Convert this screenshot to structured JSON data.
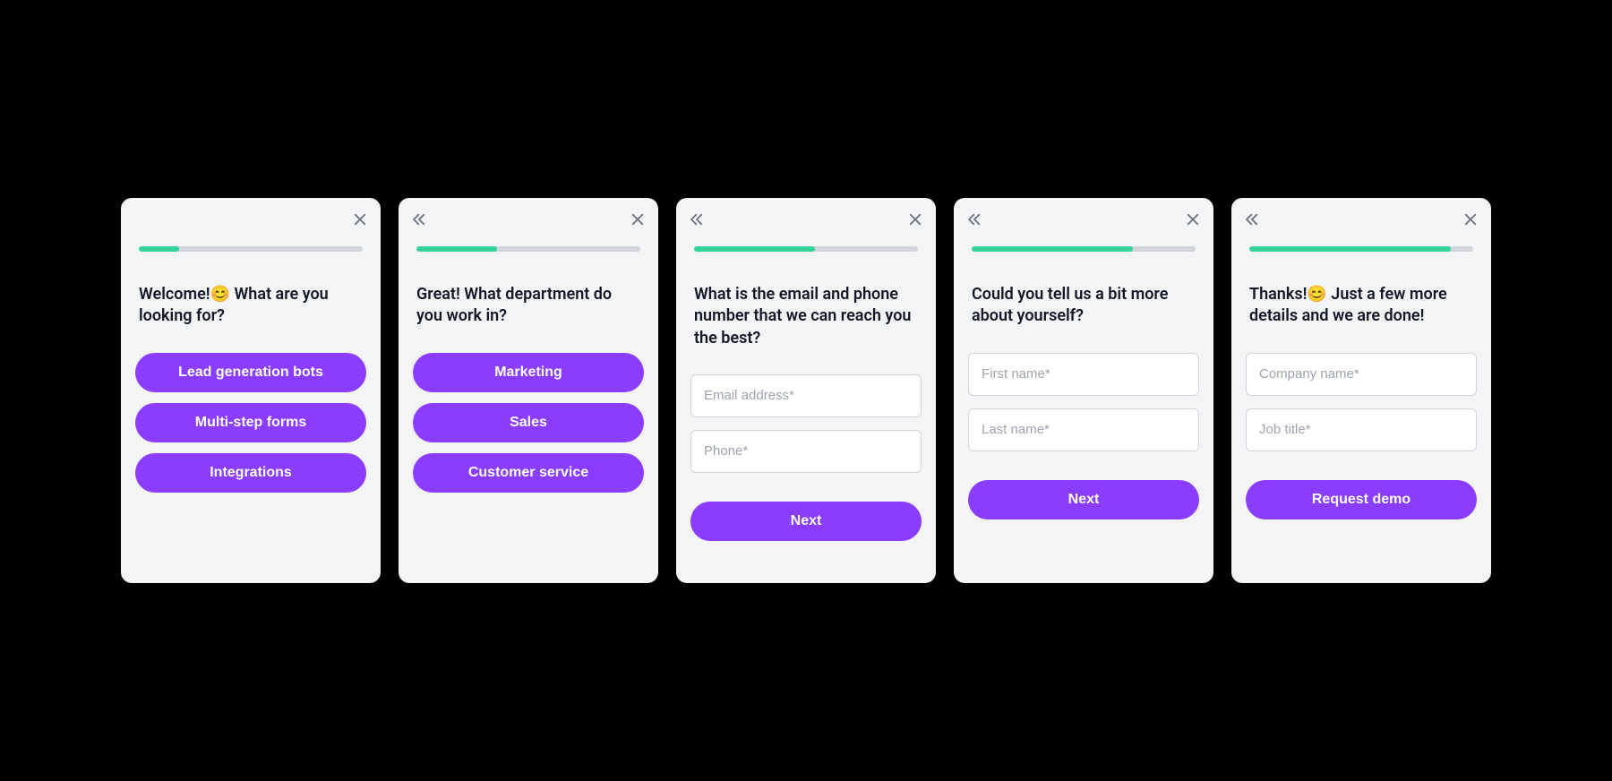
{
  "colors": {
    "accent": "#8b3dff",
    "progress": "#34d399"
  },
  "cards": [
    {
      "has_back": false,
      "progress_pct": 18,
      "prompt": "Welcome!😊 What are you looking for?",
      "type": "options",
      "options": [
        "Lead generation bots",
        "Multi-step forms",
        "Integrations"
      ]
    },
    {
      "has_back": true,
      "progress_pct": 36,
      "prompt": "Great! What department do you work in?",
      "type": "options",
      "options": [
        "Marketing",
        "Sales",
        "Customer service"
      ]
    },
    {
      "has_back": true,
      "progress_pct": 54,
      "prompt": "What is the email and phone number that we can reach you the best?",
      "type": "fields",
      "fields": [
        {
          "name": "email",
          "placeholder": "Email address*"
        },
        {
          "name": "phone",
          "placeholder": "Phone*"
        }
      ],
      "action_label": "Next"
    },
    {
      "has_back": true,
      "progress_pct": 72,
      "prompt": "Could you tell us a bit more about yourself?",
      "type": "fields",
      "fields": [
        {
          "name": "first_name",
          "placeholder": "First name*"
        },
        {
          "name": "last_name",
          "placeholder": "Last name*"
        }
      ],
      "action_label": "Next"
    },
    {
      "has_back": true,
      "progress_pct": 90,
      "prompt": "Thanks!😊 Just a few more details and we are done!",
      "type": "fields",
      "fields": [
        {
          "name": "company",
          "placeholder": "Company name*"
        },
        {
          "name": "job_title",
          "placeholder": "Job title*"
        }
      ],
      "action_label": "Request demo"
    }
  ]
}
